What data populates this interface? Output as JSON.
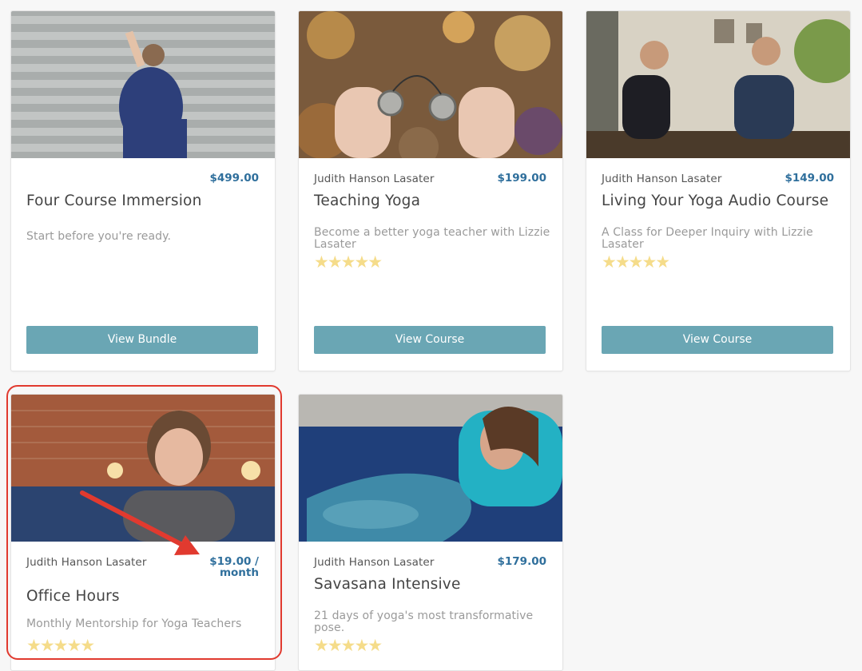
{
  "cards": [
    {
      "author": "",
      "price": "$499.00",
      "title": "Four Course Immersion",
      "subtitle": "Start before you're ready.",
      "button": "View Bundle",
      "rating": 0
    },
    {
      "author": "Judith Hanson Lasater",
      "price": "$199.00",
      "title": "Teaching Yoga",
      "subtitle": "Become a better yoga teacher with Lizzie Lasater",
      "button": "View Course",
      "rating": 5
    },
    {
      "author": "Judith Hanson Lasater",
      "price": "$149.00",
      "title": "Living Your Yoga Audio Course",
      "subtitle": "A Class for Deeper Inquiry with Lizzie Lasater",
      "button": "View Course",
      "rating": 5
    },
    {
      "author": "Judith Hanson Lasater",
      "price_line1": "$19.00 /",
      "price_line2": "month",
      "title": "Office Hours",
      "subtitle": "Monthly Mentorship for Yoga Teachers",
      "rating": 5
    },
    {
      "author": "Judith Hanson Lasater",
      "price": "$179.00",
      "title": "Savasana Intensive",
      "subtitle": "21 days of yoga's most transformative pose.",
      "rating": 5
    }
  ],
  "stars_glyph": "★★★★★",
  "colors": {
    "price": "#2f6f9c",
    "button": "#6aa6b4",
    "star": "#f5dc8a",
    "annotation": "#e13a2f"
  }
}
